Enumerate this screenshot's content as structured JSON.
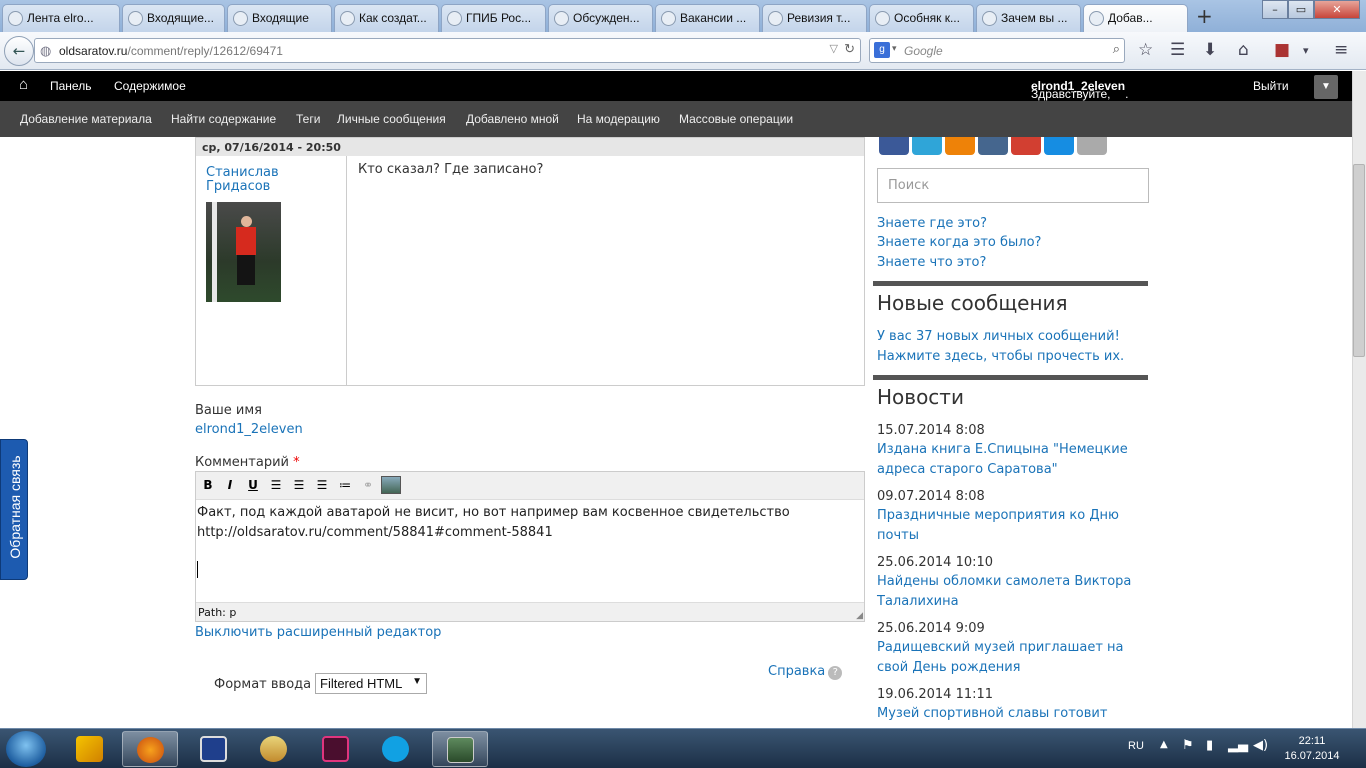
{
  "browser": {
    "tabs": [
      "Лента elro...",
      "Входящие...",
      "Входящие",
      "Как создат...",
      "ГПИБ Рос...",
      "Обсужден...",
      "Вакансии ...",
      "Ревизия т...",
      "Особняк к...",
      "Зачем вы ...",
      "Добав..."
    ],
    "url_host": "oldsaratov.ru",
    "url_path": "/comment/reply/12612/69471",
    "search_placeholder": "Google",
    "new_tab": "+"
  },
  "toolbar": {
    "home": "⌂",
    "panel": "Панель",
    "content": "Содержимое",
    "greeting": "Здравствуйте, ",
    "username": "elrond1_2eleven",
    "greeting_end": ".",
    "logout": "Выйти"
  },
  "shortcuts": [
    "Добавление материала",
    "Найти содержание",
    "Теги",
    "Личные сообщения",
    "Добавлено мной",
    "На модерацию",
    "Массовые операции"
  ],
  "comment": {
    "date": "ср, 07/16/2014 - 20:50",
    "author_line1": "Станислав",
    "author_line2": "Гридасов",
    "text": "Кто сказал? Где записано?"
  },
  "form": {
    "name_label": "Ваше имя",
    "name_value": "elrond1_2eleven",
    "comment_label": "Комментарий",
    "required_mark": "*",
    "editor_tools": {
      "bold": "B",
      "italic": "I",
      "underline": "U"
    },
    "editor_line1": "Факт, под каждой аватарой не висит, но вот например вам косвенное свидетельство",
    "editor_line2": "http://oldsaratov.ru/comment/58841#comment-58841",
    "path": "Path: p",
    "disable_editor": "Выключить расширенный редактор",
    "help": "Справка",
    "help_icon": "?",
    "format_label": "Формат ввода",
    "format_value": "Filtered HTML"
  },
  "sidebar": {
    "search_placeholder": "Поиск",
    "links": [
      "Знаете где это?",
      "Знаете когда это было?",
      "Знаете что это?"
    ],
    "messages_title": "Новые сообщения",
    "messages_line1": "У вас 37 новых личных сообщений!",
    "messages_line2": "Нажмите здесь, чтобы прочесть их.",
    "news_title": "Новости",
    "news": [
      {
        "date": "15.07.2014 8:08",
        "title": "Издана книга Е.Спицына \"Немецкие адреса старого Саратова\""
      },
      {
        "date": "09.07.2014 8:08",
        "title": "Праздничные мероприятия ко Дню почты"
      },
      {
        "date": "25.06.2014 10:10",
        "title": "Найдены обломки самолета Виктора Талалихина"
      },
      {
        "date": "25.06.2014 9:09",
        "title": "Радищевский музей приглашает на свой День рождения"
      },
      {
        "date": "19.06.2014 11:11",
        "title": "Музей спортивной славы готовит"
      }
    ]
  },
  "feedback": "Обратная связь",
  "taskbar": {
    "lang": "RU",
    "time": "22:11",
    "date": "16.07.2014"
  },
  "colors": {
    "link": "#1a73b8",
    "toolbar": "#000000",
    "shortcuts": "#444444",
    "feedback": "#1d5bb0"
  }
}
